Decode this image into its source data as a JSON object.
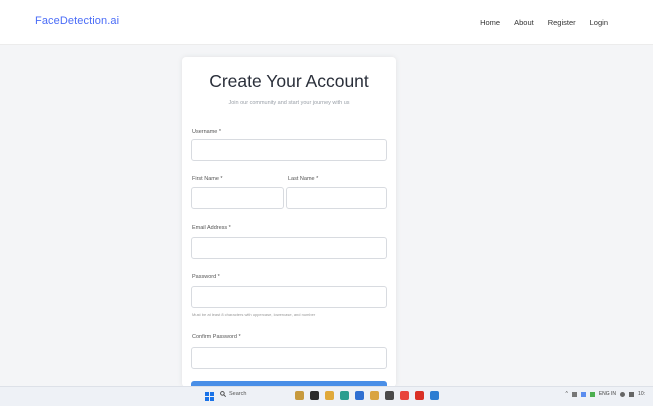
{
  "nav": {
    "brand": "FaceDetection.ai",
    "links": [
      "Home",
      "About",
      "Register",
      "Login"
    ]
  },
  "form": {
    "title": "Create Your Account",
    "subtitle": "Join our community and start your journey with us",
    "username_label": "Username *",
    "first_name_label": "First Name *",
    "last_name_label": "Last Name *",
    "email_label": "Email Address *",
    "password_label": "Password *",
    "password_hint": "Must be at least 8 characters with uppercase, lowercase, and number",
    "confirm_password_label": "Confirm Password *"
  },
  "taskbar": {
    "search_placeholder": "Search",
    "tray_lang": "ENG IN",
    "tray_time": "10:"
  },
  "colors": {
    "brand": "#4a6cf7",
    "button": "#4a8fe7"
  }
}
